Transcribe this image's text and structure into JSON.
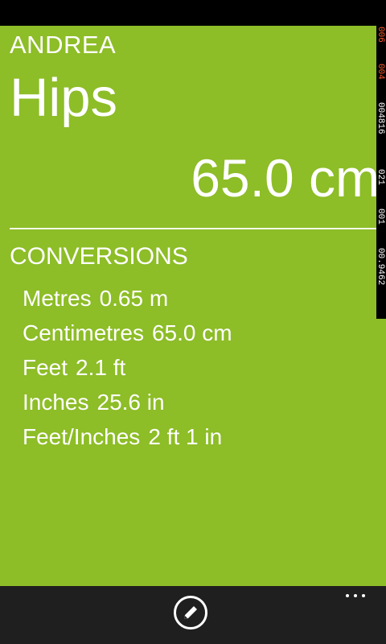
{
  "profile": {
    "name": "ANDREA"
  },
  "measurement": {
    "name": "Hips",
    "value": "65.0 cm"
  },
  "conversions": {
    "heading": "CONVERSIONS",
    "rows": [
      {
        "unit": "Metres",
        "value": "0.65 m"
      },
      {
        "unit": "Centimetres",
        "value": "65.0 cm"
      },
      {
        "unit": "Feet",
        "value": "2.1 ft"
      },
      {
        "unit": "Inches",
        "value": "25.6 in"
      },
      {
        "unit": "Feet/Inches",
        "value": "2 ft 1 in"
      }
    ]
  },
  "debug_counters": [
    "006",
    "004",
    "004816",
    "021",
    "001",
    "00.9462"
  ],
  "app_bar": {
    "edit_icon": "pencil-icon",
    "more_icon": "ellipsis-icon"
  },
  "colors": {
    "accent": "#8dbd27",
    "app_bar": "#1f1f1f",
    "status_bar": "#000000"
  }
}
